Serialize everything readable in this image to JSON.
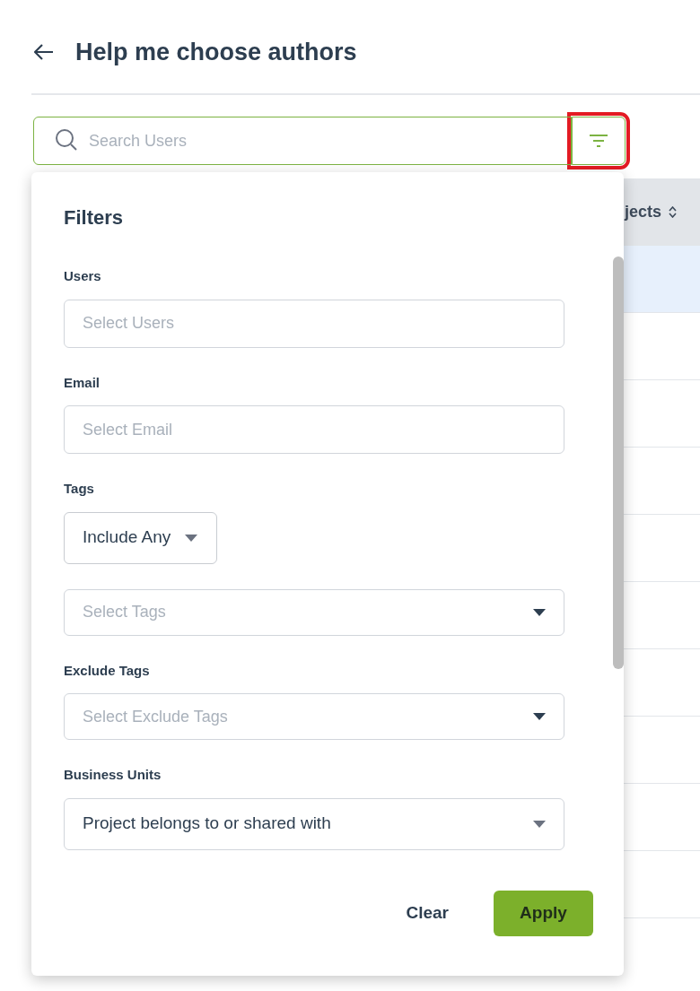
{
  "header": {
    "title": "Help me choose authors"
  },
  "search": {
    "placeholder": "Search Users"
  },
  "filter_button": {
    "highlighted": true
  },
  "table": {
    "columns": [
      {
        "label": "jects"
      }
    ],
    "rows": [
      {
        "selected": true
      },
      {
        "selected": false
      },
      {
        "selected": false
      },
      {
        "selected": false
      },
      {
        "selected": false
      },
      {
        "selected": false
      },
      {
        "selected": false
      },
      {
        "selected": false
      },
      {
        "selected": false
      },
      {
        "selected": false
      }
    ]
  },
  "filters": {
    "title": "Filters",
    "fields": [
      {
        "kind": "input",
        "label": "Users",
        "placeholder": "Select Users"
      },
      {
        "kind": "input",
        "label": "Email",
        "placeholder": "Select Email"
      },
      {
        "kind": "mode",
        "label": "Tags",
        "value": "Include Any"
      },
      {
        "kind": "select",
        "placeholder": "Select Tags"
      },
      {
        "kind": "select",
        "label": "Exclude Tags",
        "placeholder": "Select Exclude Tags"
      },
      {
        "kind": "select",
        "label": "Business Units",
        "value": "Project belongs to or shared with"
      }
    ],
    "buttons": [
      {
        "kind": "text",
        "label": "Clear"
      },
      {
        "kind": "primary",
        "label": "Apply"
      }
    ]
  }
}
